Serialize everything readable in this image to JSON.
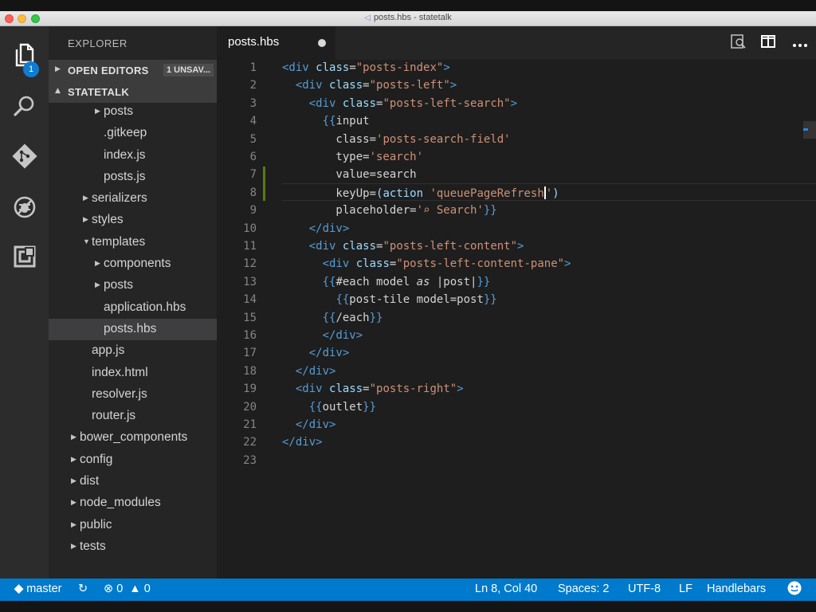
{
  "window": {
    "title": "posts.hbs - statetalk"
  },
  "activity_bar": {
    "items": [
      {
        "icon": "files-icon",
        "badge": "1"
      },
      {
        "icon": "search-icon"
      },
      {
        "icon": "git-icon"
      },
      {
        "icon": "debug-icon"
      },
      {
        "icon": "extensions-icon"
      }
    ]
  },
  "sidebar": {
    "title": "EXPLORER",
    "open_editors": {
      "label": "OPEN EDITORS",
      "badge": "1 UNSAV..."
    },
    "project": {
      "label": "STATETALK"
    },
    "tree": [
      {
        "label": "posts",
        "twisty": "▶",
        "depth": 3,
        "kind": "folder"
      },
      {
        "label": ".gitkeep",
        "depth": 3,
        "kind": "file"
      },
      {
        "label": "index.js",
        "depth": 3,
        "kind": "file"
      },
      {
        "label": "posts.js",
        "depth": 3,
        "kind": "file"
      },
      {
        "label": "serializers",
        "twisty": "▶",
        "depth": 2,
        "kind": "folder"
      },
      {
        "label": "styles",
        "twisty": "▶",
        "depth": 2,
        "kind": "folder"
      },
      {
        "label": "templates",
        "twisty": "▼",
        "depth": 2,
        "kind": "folder"
      },
      {
        "label": "components",
        "twisty": "▶",
        "depth": 3,
        "kind": "folder"
      },
      {
        "label": "posts",
        "twisty": "▶",
        "depth": 3,
        "kind": "folder"
      },
      {
        "label": "application.hbs",
        "depth": 3,
        "kind": "file"
      },
      {
        "label": "posts.hbs",
        "depth": 3,
        "kind": "file",
        "selected": true
      },
      {
        "label": "app.js",
        "depth": 2,
        "kind": "file"
      },
      {
        "label": "index.html",
        "depth": 2,
        "kind": "file"
      },
      {
        "label": "resolver.js",
        "depth": 2,
        "kind": "file"
      },
      {
        "label": "router.js",
        "depth": 2,
        "kind": "file"
      },
      {
        "label": "bower_components",
        "twisty": "▶",
        "depth": 1,
        "kind": "folder"
      },
      {
        "label": "config",
        "twisty": "▶",
        "depth": 1,
        "kind": "folder"
      },
      {
        "label": "dist",
        "twisty": "▶",
        "depth": 1,
        "kind": "folder"
      },
      {
        "label": "node_modules",
        "twisty": "▶",
        "depth": 1,
        "kind": "folder"
      },
      {
        "label": "public",
        "twisty": "▶",
        "depth": 1,
        "kind": "folder"
      },
      {
        "label": "tests",
        "twisty": "▶",
        "depth": 1,
        "kind": "folder"
      }
    ]
  },
  "tabs": [
    {
      "label": "posts.hbs",
      "dirty": true,
      "active": true
    }
  ],
  "editor": {
    "cursor": {
      "line": 8
    },
    "modified_lines": [
      7,
      8
    ],
    "lines": [
      [
        [
          "t",
          "<div "
        ],
        [
          "a",
          "class"
        ],
        [
          "p",
          "="
        ],
        [
          "s",
          "\"posts-index\""
        ],
        [
          "t",
          ">"
        ]
      ],
      [
        [
          "p",
          "  "
        ],
        [
          "t",
          "<div "
        ],
        [
          "a",
          "class"
        ],
        [
          "p",
          "="
        ],
        [
          "s",
          "\"posts-left\""
        ],
        [
          "t",
          ">"
        ]
      ],
      [
        [
          "p",
          "    "
        ],
        [
          "t",
          "<div "
        ],
        [
          "a",
          "class"
        ],
        [
          "p",
          "="
        ],
        [
          "s",
          "\"posts-left-search\""
        ],
        [
          "t",
          ">"
        ]
      ],
      [
        [
          "p",
          "      "
        ],
        [
          "b",
          "{{"
        ],
        [
          "p",
          "input"
        ]
      ],
      [
        [
          "p",
          "        class="
        ],
        [
          "s",
          "'posts-search-field'"
        ]
      ],
      [
        [
          "p",
          "        type="
        ],
        [
          "s",
          "'search'"
        ]
      ],
      [
        [
          "p",
          "        value=search"
        ]
      ],
      [
        [
          "p",
          "        keyUp="
        ],
        [
          "a",
          "(action "
        ],
        [
          "s",
          "'queuePageRefresh"
        ],
        [
          "c",
          ""
        ],
        [
          "s",
          "'"
        ],
        [
          "a",
          ")"
        ]
      ],
      [
        [
          "p",
          "        placeholder="
        ],
        [
          "s",
          "'⌕ Search'"
        ],
        [
          "b",
          "}}"
        ]
      ],
      [
        [
          "p",
          "    "
        ],
        [
          "t",
          "</div>"
        ]
      ],
      [
        [
          "p",
          "    "
        ],
        [
          "t",
          "<div "
        ],
        [
          "a",
          "class"
        ],
        [
          "p",
          "="
        ],
        [
          "s",
          "\"posts-left-content\""
        ],
        [
          "t",
          ">"
        ]
      ],
      [
        [
          "p",
          "      "
        ],
        [
          "t",
          "<div "
        ],
        [
          "a",
          "class"
        ],
        [
          "p",
          "="
        ],
        [
          "s",
          "\"posts-left-content-pane\""
        ],
        [
          "t",
          ">"
        ]
      ],
      [
        [
          "p",
          "      "
        ],
        [
          "b",
          "{{"
        ],
        [
          "p",
          "#each model "
        ],
        [
          "k",
          "as"
        ],
        [
          "p",
          " |post|"
        ],
        [
          "b",
          "}}"
        ]
      ],
      [
        [
          "p",
          "        "
        ],
        [
          "b",
          "{{"
        ],
        [
          "p",
          "post-tile model=post"
        ],
        [
          "b",
          "}}"
        ]
      ],
      [
        [
          "p",
          "      "
        ],
        [
          "b",
          "{{"
        ],
        [
          "p",
          "/each"
        ],
        [
          "b",
          "}}"
        ]
      ],
      [
        [
          "p",
          "      "
        ],
        [
          "t",
          "</div>"
        ]
      ],
      [
        [
          "p",
          "    "
        ],
        [
          "t",
          "</div>"
        ]
      ],
      [
        [
          "p",
          "  "
        ],
        [
          "t",
          "</div>"
        ]
      ],
      [
        [
          "p",
          "  "
        ],
        [
          "t",
          "<div "
        ],
        [
          "a",
          "class"
        ],
        [
          "p",
          "="
        ],
        [
          "s",
          "\"posts-right\""
        ],
        [
          "t",
          ">"
        ]
      ],
      [
        [
          "p",
          "    "
        ],
        [
          "b",
          "{{"
        ],
        [
          "p",
          "outlet"
        ],
        [
          "b",
          "}}"
        ]
      ],
      [
        [
          "p",
          "  "
        ],
        [
          "t",
          "</div>"
        ]
      ],
      [
        [
          "t",
          "</div>"
        ]
      ],
      []
    ]
  },
  "status_bar": {
    "branch": "master",
    "errors": "0",
    "warnings": "0",
    "position": "Ln 8, Col 40",
    "indent": "Spaces: 2",
    "encoding": "UTF-8",
    "eol": "LF",
    "language": "Handlebars"
  },
  "colors": {
    "status_bar": "#007acc",
    "tag": "#569cd6",
    "attribute": "#9cdcfe",
    "string": "#ce9178",
    "badge": "#0e7cd0"
  }
}
